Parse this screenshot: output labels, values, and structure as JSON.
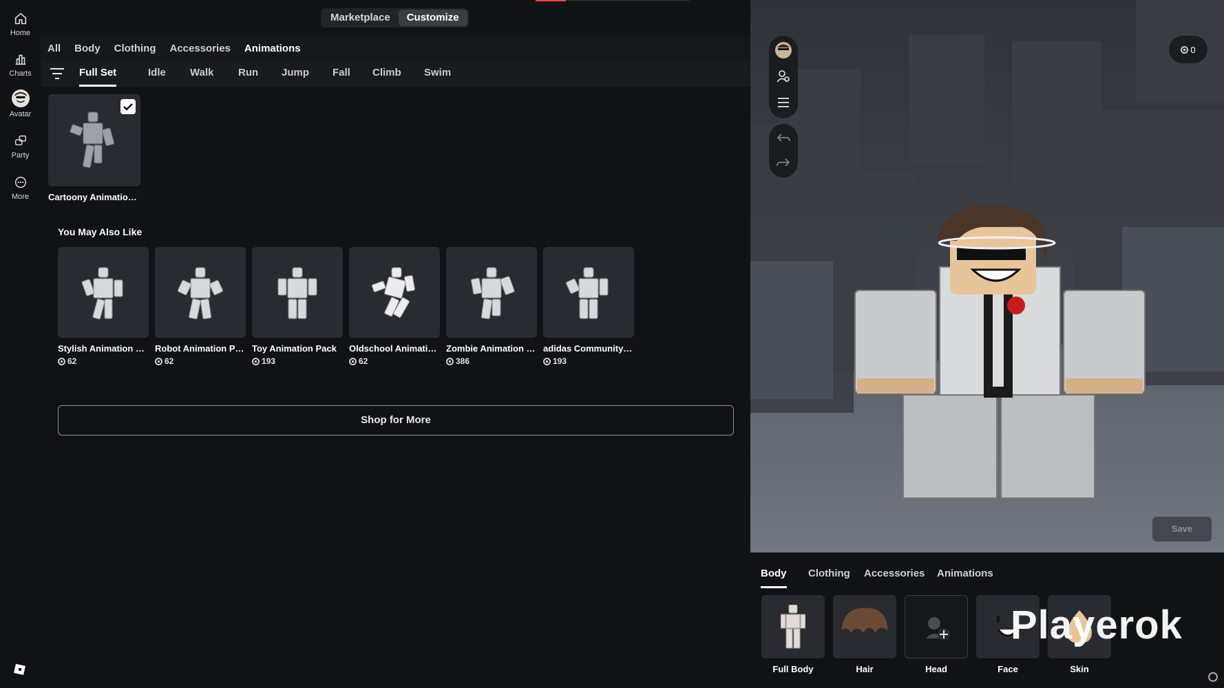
{
  "rail": {
    "items": [
      {
        "label": "Home",
        "icon": "home-icon"
      },
      {
        "label": "Charts",
        "icon": "charts-icon"
      },
      {
        "label": "Avatar",
        "icon": "avatar-icon"
      },
      {
        "label": "Party",
        "icon": "party-icon"
      },
      {
        "label": "More",
        "icon": "more-icon"
      }
    ],
    "logo": "roblox-logo-icon"
  },
  "top_toggle": {
    "marketplace": "Marketplace",
    "customize": "Customize",
    "active": "Customize"
  },
  "category_tabs": [
    "All",
    "Body",
    "Clothing",
    "Accessories",
    "Animations"
  ],
  "active_category": "Animations",
  "sub_tabs": [
    "Full Set",
    "Idle",
    "Walk",
    "Run",
    "Jump",
    "Fall",
    "Climb",
    "Swim"
  ],
  "active_sub_tab": "Full Set",
  "owned_items": [
    {
      "name": "Cartoony Animation Package",
      "selected": true
    }
  ],
  "recommendations": {
    "title": "You May Also Like",
    "items": [
      {
        "name": "Stylish Animation Pack",
        "price": "62"
      },
      {
        "name": "Robot Animation Pack",
        "price": "62"
      },
      {
        "name": "Toy Animation Pack",
        "price": "193"
      },
      {
        "name": "Oldschool Animation Pack",
        "price": "62"
      },
      {
        "name": "Zombie Animation Pack",
        "price": "386"
      },
      {
        "name": "adidas Community Animation Pack",
        "price": "193"
      }
    ]
  },
  "shop_more": "Shop for More",
  "viewport": {
    "balance": "0",
    "save": "Save"
  },
  "bottom": {
    "tabs": [
      "Body",
      "Clothing",
      "Accessories",
      "Animations"
    ],
    "active_tab": "Body",
    "items": [
      {
        "label": "Full Body"
      },
      {
        "label": "Hair"
      },
      {
        "label": "Head"
      },
      {
        "label": "Face"
      },
      {
        "label": "Skin"
      }
    ]
  },
  "watermark": "Playerok",
  "colors": {
    "accent_red": "#e8473a",
    "background": "#111216",
    "card": "#2a2b30"
  }
}
